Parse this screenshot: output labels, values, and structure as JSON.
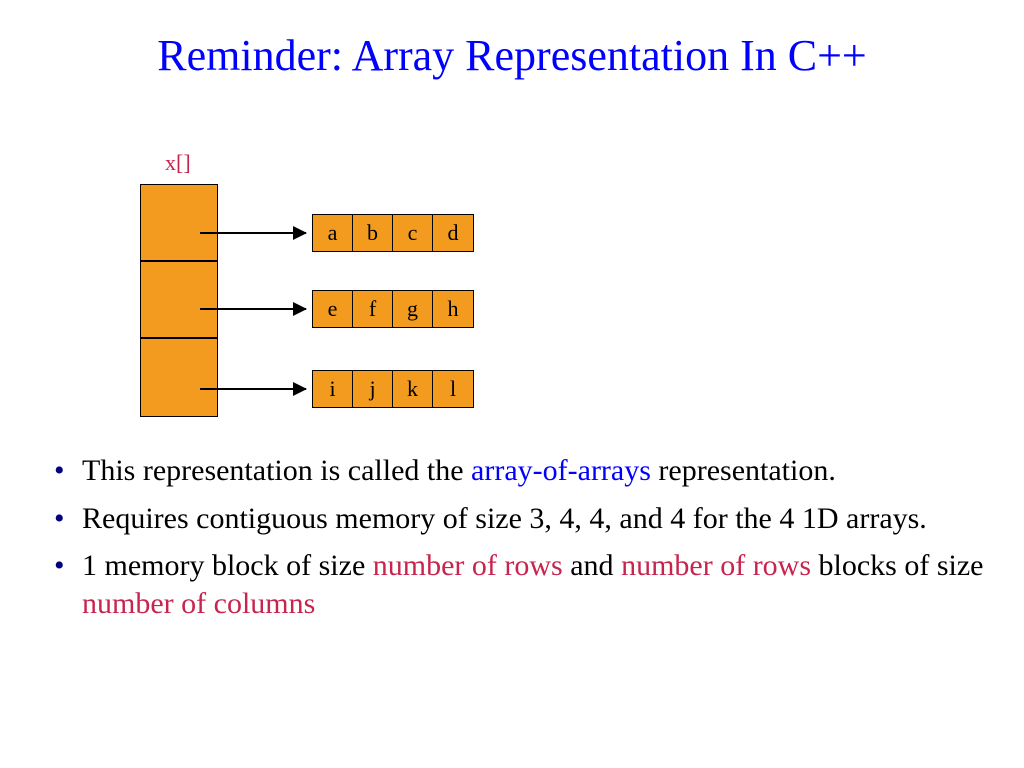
{
  "title": "Reminder: Array Representation In C++",
  "diagram": {
    "label": "x[]",
    "rows": [
      [
        "a",
        "b",
        "c",
        "d"
      ],
      [
        "e",
        "f",
        "g",
        "h"
      ],
      [
        "i",
        "j",
        "k",
        "l"
      ]
    ]
  },
  "bullets": {
    "b1_part1": "This representation is called the ",
    "b1_blue": "array-of-arrays",
    "b1_part2": " representation.",
    "b2": "Requires contiguous memory of size 3, 4, 4, and 4 for the 4 1D arrays.",
    "b3_part1": "1 memory block of size ",
    "b3_pink1": "number of rows",
    "b3_part2": " and ",
    "b3_pink2": "number of rows",
    "b3_part3": " blocks of size ",
    "b3_pink3": "number of columns"
  }
}
